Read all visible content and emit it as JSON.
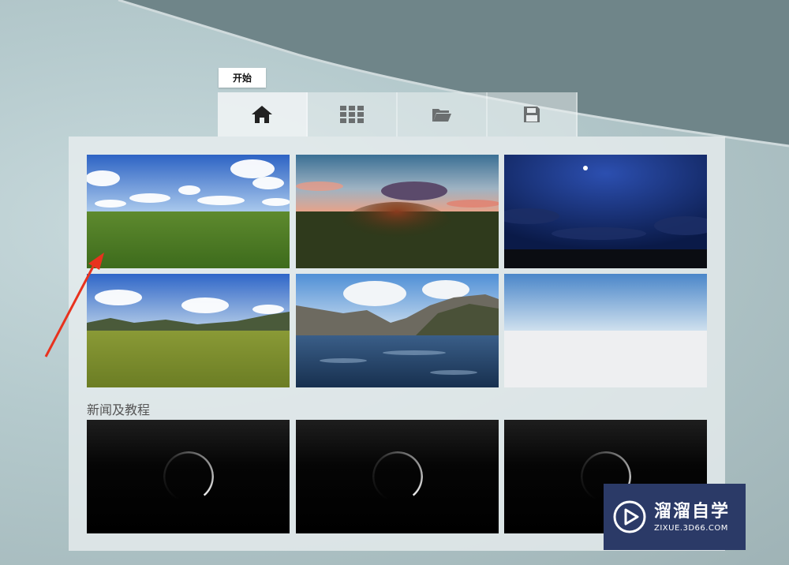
{
  "tooltip": {
    "text": "开始"
  },
  "tabs": [
    {
      "icon": "home-icon",
      "active": true
    },
    {
      "icon": "grid-icon",
      "active": false
    },
    {
      "icon": "folder-icon",
      "active": false
    },
    {
      "icon": "save-icon",
      "active": false
    }
  ],
  "environments": [
    {
      "name": "grass-day"
    },
    {
      "name": "sunset"
    },
    {
      "name": "night"
    },
    {
      "name": "hills"
    },
    {
      "name": "mountain-lake"
    },
    {
      "name": "plain-sky"
    }
  ],
  "news": {
    "title": "新闻及教程",
    "items": [
      {
        "state": "loading"
      },
      {
        "state": "loading"
      },
      {
        "state": "loading"
      }
    ]
  },
  "watermark": {
    "title": "溜溜自学",
    "url": "ZIXUE.3D66.COM"
  },
  "colors": {
    "accent_arrow": "#e8321e",
    "watermark_bg": "#2b3a67"
  }
}
